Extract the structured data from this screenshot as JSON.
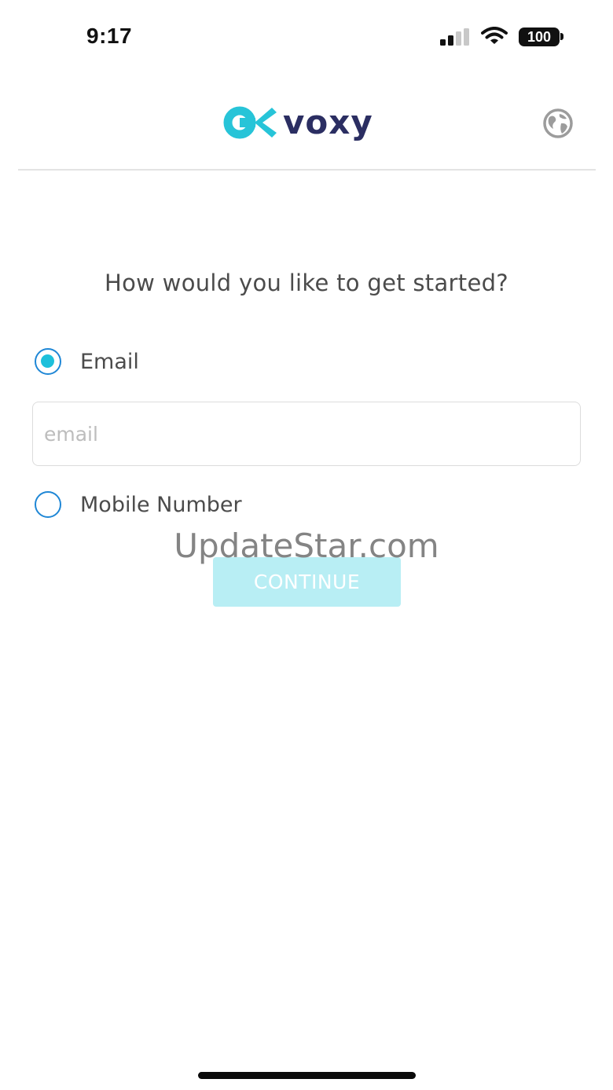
{
  "status_bar": {
    "time": "9:17",
    "battery": "100",
    "icons": [
      "signal-icon",
      "wifi-icon",
      "battery-icon"
    ]
  },
  "header": {
    "logo_text": "voxy",
    "logo_color": "#2b2e62",
    "logo_mark_color": "#27c4d8",
    "language_icon": "globe-icon"
  },
  "main": {
    "question": "How would you like to get started?",
    "options": [
      {
        "label": "Email",
        "selected": true
      },
      {
        "label": "Mobile Number",
        "selected": false
      }
    ],
    "email_input": {
      "value": "",
      "placeholder": "email"
    },
    "continue_label": "CONTINUE"
  },
  "watermark": "UpdateStar.com",
  "colors": {
    "accent": "#1ec0db",
    "radio_border": "#1f87d6",
    "button_disabled": "#b8eef4"
  }
}
